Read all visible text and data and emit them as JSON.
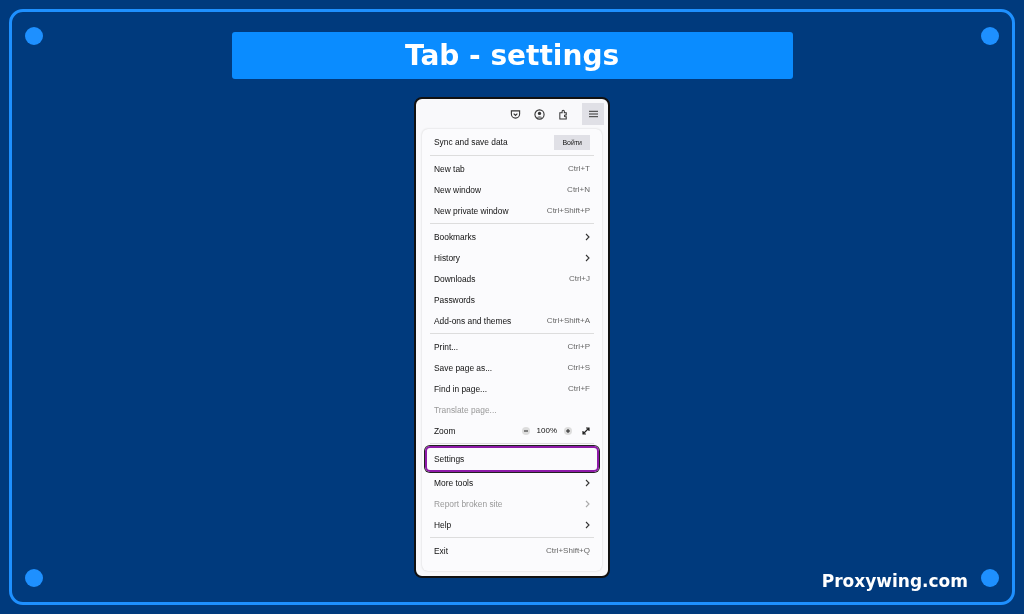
{
  "title": "Tab - settings",
  "account": {
    "label": "Sync and save data",
    "button": "Войти"
  },
  "sections": [
    [
      {
        "kind": "item",
        "label": "New tab",
        "shortcut": "Ctrl+T",
        "disabled": false,
        "selected": false
      },
      {
        "kind": "item",
        "label": "New window",
        "shortcut": "Ctrl+N",
        "disabled": false,
        "selected": false
      },
      {
        "kind": "item",
        "label": "New private window",
        "shortcut": "Ctrl+Shift+P",
        "disabled": false,
        "selected": false
      }
    ],
    [
      {
        "kind": "submenu",
        "label": "Bookmarks",
        "disabled": false,
        "selected": false
      },
      {
        "kind": "submenu",
        "label": "History",
        "disabled": false,
        "selected": false
      },
      {
        "kind": "item",
        "label": "Downloads",
        "shortcut": "Ctrl+J",
        "disabled": false,
        "selected": false
      },
      {
        "kind": "item",
        "label": "Passwords",
        "disabled": false,
        "selected": false
      },
      {
        "kind": "item",
        "label": "Add-ons and themes",
        "shortcut": "Ctrl+Shift+A",
        "disabled": false,
        "selected": false
      }
    ],
    [
      {
        "kind": "item",
        "label": "Print...",
        "shortcut": "Ctrl+P",
        "disabled": false,
        "selected": false
      },
      {
        "kind": "item",
        "label": "Save page as...",
        "shortcut": "Ctrl+S",
        "disabled": false,
        "selected": false
      },
      {
        "kind": "item",
        "label": "Find in page...",
        "shortcut": "Ctrl+F",
        "disabled": false,
        "selected": false
      },
      {
        "kind": "item",
        "label": "Translate page...",
        "disabled": true,
        "selected": false
      },
      {
        "kind": "zoom",
        "label": "Zoom",
        "value": "100%",
        "disabled": false,
        "selected": false
      }
    ],
    [
      {
        "kind": "item",
        "label": "Settings",
        "disabled": false,
        "selected": true
      },
      {
        "kind": "submenu",
        "label": "More tools",
        "disabled": false,
        "selected": false
      },
      {
        "kind": "submenu",
        "label": "Report broken site",
        "disabled": true,
        "selected": false
      },
      {
        "kind": "submenu",
        "label": "Help",
        "disabled": false,
        "selected": false
      }
    ],
    [
      {
        "kind": "item",
        "label": "Exit",
        "shortcut": "Ctrl+Shift+Q",
        "disabled": false,
        "selected": false
      }
    ]
  ],
  "footer": "Proxywing.com"
}
